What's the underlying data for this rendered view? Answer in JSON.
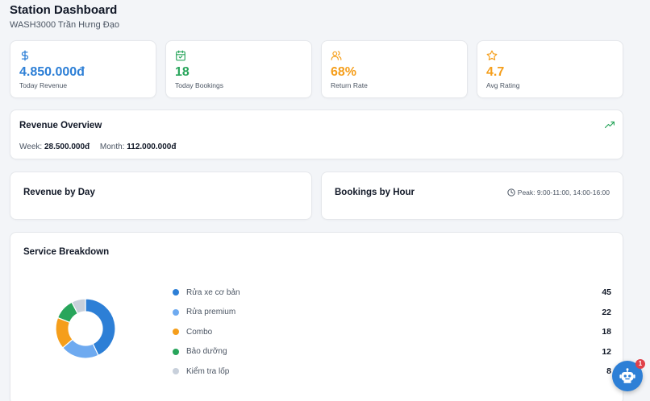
{
  "header": {
    "title": "Station Dashboard",
    "subtitle": "WASH3000 Trần Hưng Đạo"
  },
  "stats": [
    {
      "value": "4.850.000đ",
      "label": "Today Revenue",
      "icon": "dollar-icon",
      "color": "#2d7fd6"
    },
    {
      "value": "18",
      "label": "Today Bookings",
      "icon": "calendar-icon",
      "color": "#28a55b"
    },
    {
      "value": "68%",
      "label": "Return Rate",
      "icon": "users-icon",
      "color": "#f59e1b"
    },
    {
      "value": "4.7",
      "label": "Avg Rating",
      "icon": "star-icon",
      "color": "#f59e1b"
    }
  ],
  "revenue_overview": {
    "title": "Revenue Overview",
    "week_label": "Week:",
    "week_value": "28.500.000đ",
    "month_label": "Month:",
    "month_value": "112.000.000đ",
    "trend_icon": "trending-up-icon"
  },
  "revenue_by_day": {
    "title": "Revenue by Day"
  },
  "bookings_by_hour": {
    "title": "Bookings by Hour",
    "peak": "Peak: 9:00-11:00, 14:00-16:00",
    "icon": "clock-icon"
  },
  "service_breakdown": {
    "title": "Service Breakdown",
    "items": [
      {
        "name": "Rửa xe cơ bản",
        "count": 45,
        "color": "#2d7fd6"
      },
      {
        "name": "Rửa premium",
        "count": 22,
        "color": "#6eaaf0"
      },
      {
        "name": "Combo",
        "count": 18,
        "color": "#f59e1b"
      },
      {
        "name": "Bảo dưỡng",
        "count": 12,
        "color": "#28a55b"
      },
      {
        "name": "Kiểm tra lốp",
        "count": 8,
        "color": "#c8d0db"
      }
    ]
  },
  "assistant": {
    "icon": "robot-icon",
    "badge": "1"
  }
}
